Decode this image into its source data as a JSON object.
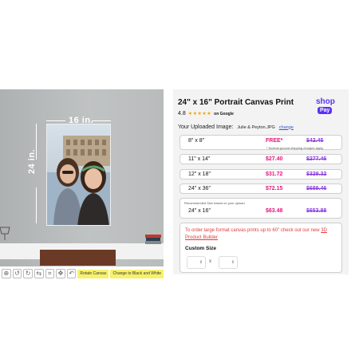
{
  "product": {
    "title": "24\" x 16\" Portrait Canvas Print",
    "rating_value": "4.8",
    "rating_stars": "★★★★★",
    "rating_source": "on Google"
  },
  "checkout": {
    "brand": "shop",
    "pay_badge": "Pay",
    "brand_color": "#5a31f4"
  },
  "preview": {
    "width_label": "16 in.",
    "height_label": "24 in."
  },
  "toolbar": {
    "tools": [
      "zoom-in-icon",
      "rotate-left-icon",
      "rotate-right-icon",
      "flip-icon",
      "crop-icon",
      "move-icon",
      "undo-icon"
    ],
    "tag_1": "Rotate Canvas",
    "tag_2": "Change to Black and White"
  },
  "upload": {
    "label": "Your Uploaded Image:",
    "filename": "Julie & Peyton.JPG",
    "change_link": "change"
  },
  "options": [
    {
      "size": "8\" x 8\"",
      "price": "FREE*",
      "was": "$42.45",
      "note": "* Normal ground shipping charges apply"
    },
    {
      "size": "11\" x 14\"",
      "price": "$27.40",
      "was": "$277.46"
    },
    {
      "size": "12\" x 18\"",
      "price": "$31.72",
      "was": "$329.32"
    },
    {
      "size": "24\" x 36\"",
      "price": "$72.15",
      "was": "$689.46"
    },
    {
      "size": "24\" x 16\"",
      "price": "$63.48",
      "was": "$653.88",
      "recommended": "Recommended Size based on your upload"
    }
  ],
  "custom": {
    "note": "To order large format canvas prints up to 60\" check out our new",
    "link": "3D Product Builder",
    "label": "Custom Size",
    "separator": "x"
  },
  "colors": {
    "sale_price": "#e6147b",
    "was_price": "#8a3fe0",
    "notice_text": "#e03b3b",
    "panel_bg": "#f3f3f3"
  }
}
